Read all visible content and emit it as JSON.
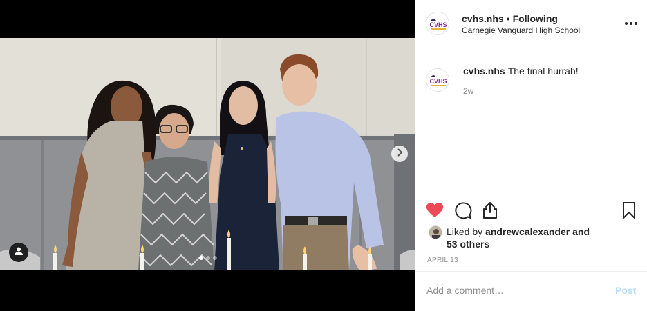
{
  "post": {
    "username": "cvhs.nhs",
    "separator": "•",
    "follow_status": "Following",
    "location": "Carnegie Vanguard High School",
    "avatar_logo_text": "CVHS",
    "caption_username": "cvhs.nhs",
    "caption_text": "The final hurrah!",
    "caption_time": "2w",
    "likes_text_prefix": "Liked by ",
    "likes_user": "andrewcalexander",
    "likes_and": " and",
    "likes_others": "53 others",
    "date": "APRIL 13"
  },
  "carousel": {
    "total": 3,
    "active_index": 0
  },
  "icons": {
    "more": "more-options-icon",
    "like": "heart-icon",
    "comment": "comment-icon",
    "share": "share-icon",
    "save": "bookmark-icon",
    "next": "chevron-right-icon",
    "tag": "user-tag-icon"
  },
  "comment": {
    "placeholder": "Add a comment…",
    "post_label": "Post"
  },
  "colors": {
    "like_active": "#ed4956",
    "post_disabled": "#b2dffc",
    "text": "#262626",
    "muted": "#8e8e8e"
  }
}
